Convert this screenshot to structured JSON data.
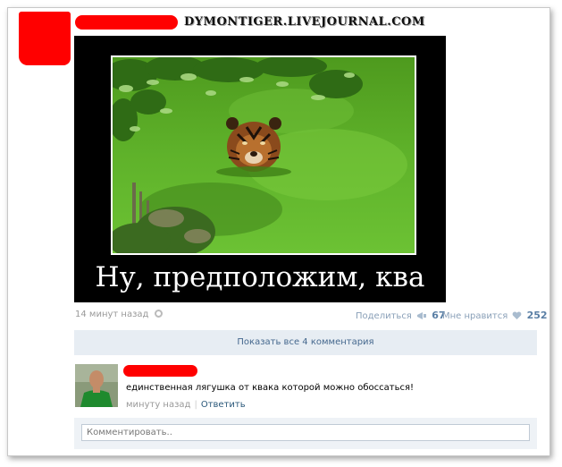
{
  "post": {
    "watermark": "DYMONTIGER.LIVEJOURNAL.COM",
    "caption": "Ну, предположим, ква",
    "time": "14 минут назад",
    "share_label": "Поделиться",
    "share_count": "67",
    "like_label": "Мне нравится",
    "like_count": "252"
  },
  "comments": {
    "show_all": "Показать все 4 комментария",
    "items": [
      {
        "text": "единственная лягушка от квака которой можно обоссаться!",
        "time": "минуту назад",
        "reply": "Ответить"
      }
    ],
    "input_placeholder": "Комментировать.."
  },
  "icons": {
    "gear": "gear-icon",
    "share": "megaphone-icon",
    "like": "heart-icon"
  },
  "colors": {
    "redaction": "#ff0000",
    "link": "#45688e",
    "count": "#5a7fa5",
    "panel": "#e7edf3"
  }
}
